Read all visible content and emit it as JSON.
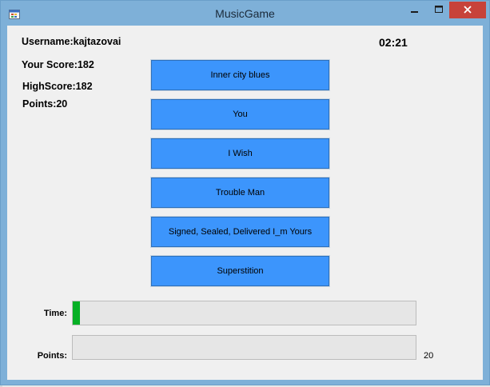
{
  "window": {
    "title": "MusicGame",
    "controls": {
      "minimize": "minimize-icon",
      "maximize": "maximize-icon",
      "close": "close-icon"
    }
  },
  "player": {
    "username_label": "Username:kajtazovai",
    "score_label": "Your Score:182",
    "highscore_label": "HighScore:182",
    "points_label": "Points:20"
  },
  "timer": {
    "display": "02:21"
  },
  "answers": [
    {
      "label": "Inner city blues"
    },
    {
      "label": "You"
    },
    {
      "label": "I Wish"
    },
    {
      "label": "Trouble Man"
    },
    {
      "label": "Signed, Sealed, Delivered I_m Yours"
    },
    {
      "label": "Superstition"
    }
  ],
  "progress": {
    "time": {
      "label": "Time:",
      "fraction": 0.02,
      "color": "#06b025"
    },
    "points": {
      "label": "Points:",
      "fraction": 0,
      "value": "20"
    }
  },
  "colors": {
    "answer_button": "#3c95fc",
    "titlebar": "#7eb0d8",
    "close_button": "#c7423a"
  }
}
